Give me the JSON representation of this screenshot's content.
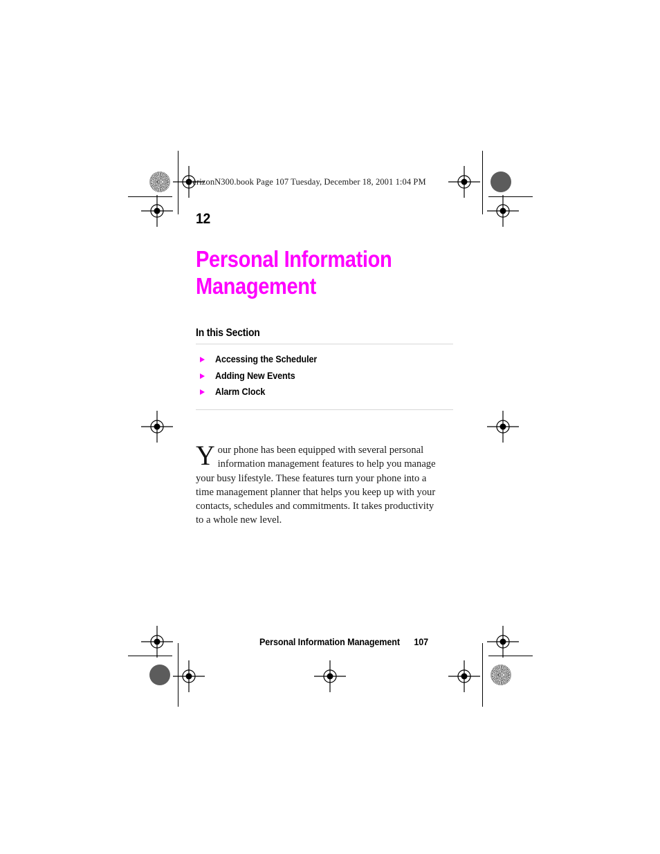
{
  "document": {
    "running_head": "verizonN300.book  Page 107  Tuesday, December 18, 2001  1:04 PM",
    "chapter_number": "12",
    "chapter_title": "Personal Information Management",
    "accent_color": "#FF00FF",
    "rule_color": "#d7d7d7",
    "text_color": "#1a1a1a"
  },
  "section": {
    "heading": "In this Section",
    "items": [
      {
        "label": "Accessing the Scheduler",
        "bullet": "triangle-right-icon"
      },
      {
        "label": "Adding New Events",
        "bullet": "triangle-right-icon"
      },
      {
        "label": "Alarm Clock",
        "bullet": "triangle-right-icon"
      }
    ]
  },
  "intro": {
    "dropcap": "Y",
    "body": "our phone has been equipped with several personal information management features to help you manage your busy lifestyle. These features turn your phone into a time management planner that helps you keep up with your contacts, schedules and commitments. It takes productivity to a whole new level."
  },
  "footer": {
    "title": "Personal Information Management",
    "page_number": "107"
  },
  "print_marks": {
    "registration_icon": "registration-crosshair-icon",
    "star_target_icon": "star-target-icon",
    "density_dot_icon": "density-dot-icon",
    "trim_line_icon": "trim-line-icon"
  }
}
